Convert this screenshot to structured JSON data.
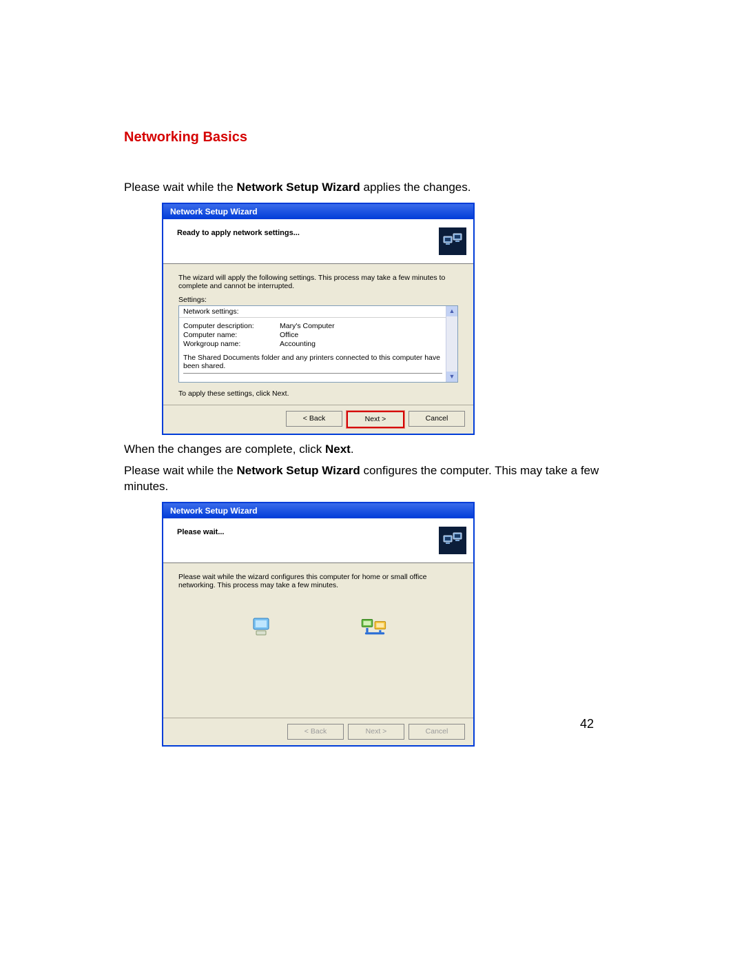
{
  "heading": "Networking Basics",
  "intro_pre": "Please wait while the ",
  "intro_bold": "Network Setup Wizard",
  "intro_post": " applies the changes.",
  "mid1": "When the changes are complete, click ",
  "mid1_bold": "Next",
  "mid1_post": ".",
  "mid2_pre": "Please wait while the ",
  "mid2_bold": "Network Setup Wizard",
  "mid2_post": " configures the computer. This may take a few minutes.",
  "page_number": "42",
  "wizard1": {
    "title": "Network Setup Wizard",
    "head": "Ready to apply network settings...",
    "desc": "The wizard will apply the following settings. This process may take a few minutes to complete and cannot be interrupted.",
    "settings_label": "Settings:",
    "net_header": "Network settings:",
    "rows": {
      "desc_k": "Computer description:",
      "desc_v": "Mary's Computer",
      "name_k": "Computer name:",
      "name_v": "Office",
      "wg_k": "Workgroup name:",
      "wg_v": "Accounting"
    },
    "shared_note": "The Shared Documents folder and any printers connected to this computer have been shared.",
    "apply_note": "To apply these settings, click Next.",
    "back": "< Back",
    "next": "Next >",
    "cancel": "Cancel"
  },
  "wizard2": {
    "title": "Network Setup Wizard",
    "head": "Please wait...",
    "desc": "Please wait while the wizard configures this computer for home or small office networking. This process may take a few minutes.",
    "back": "< Back",
    "next": "Next >",
    "cancel": "Cancel"
  }
}
